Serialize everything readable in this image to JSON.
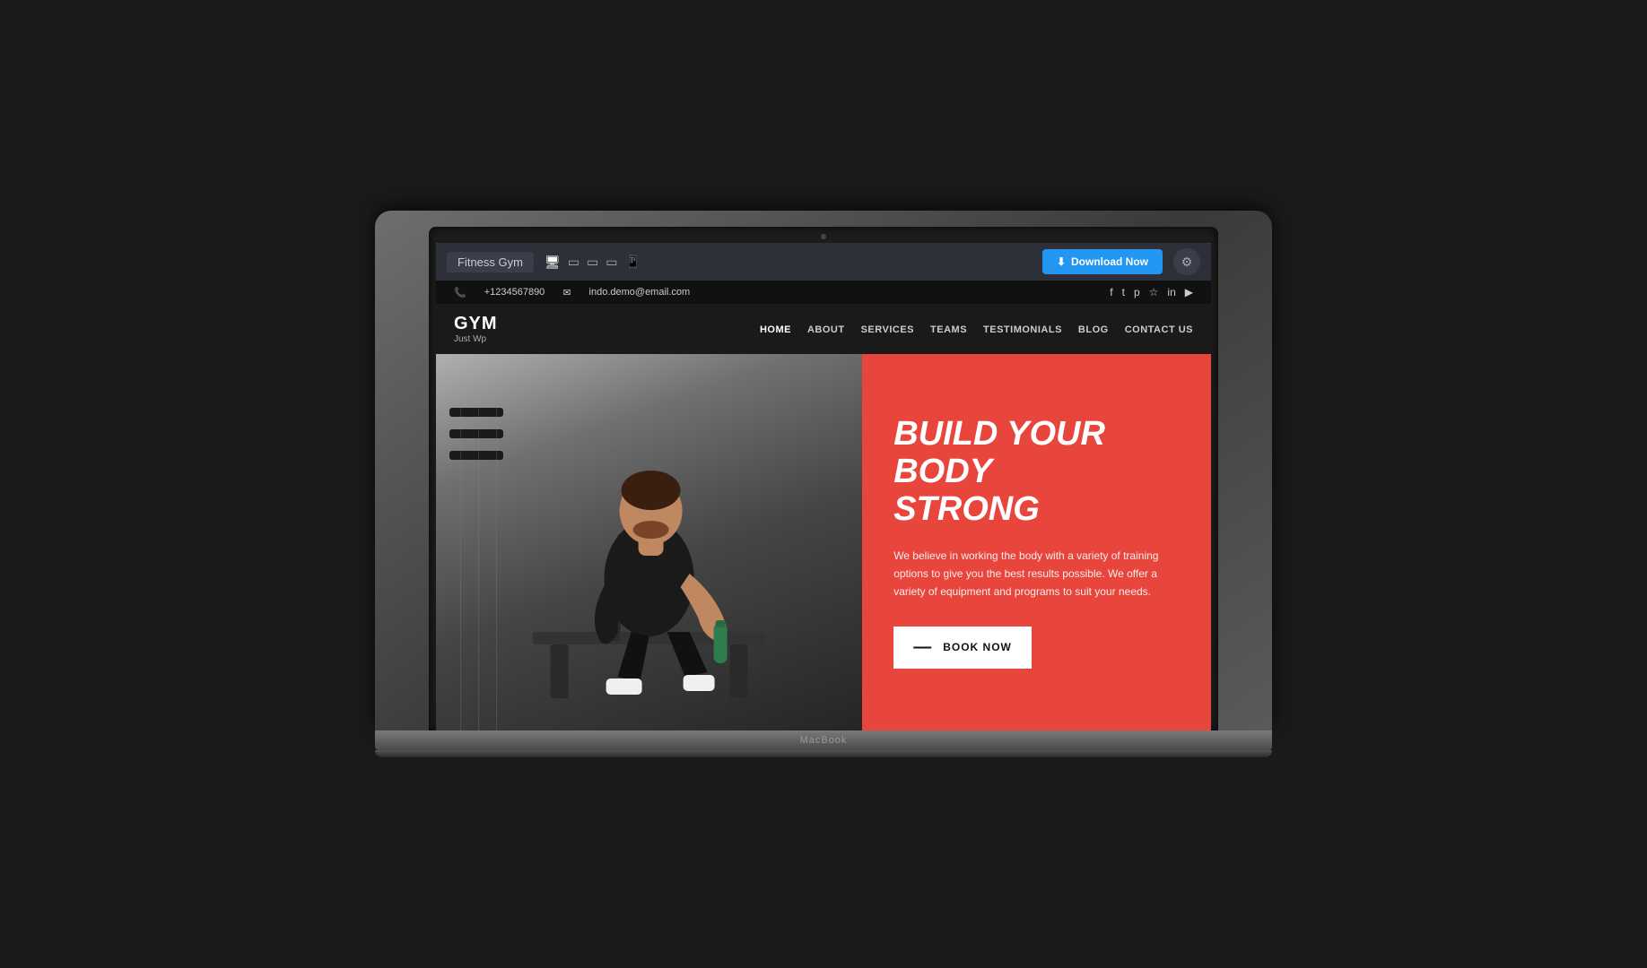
{
  "editor": {
    "template_name": "Fitness Gym",
    "download_btn": "Download Now",
    "settings_icon": "⚙",
    "download_icon": "⬇"
  },
  "contact_bar": {
    "phone": "+1234567890",
    "email": "indo.demo@email.com",
    "social_icons": [
      "f",
      "t",
      "p",
      "i",
      "in",
      "yt"
    ]
  },
  "nav": {
    "logo_name": "GYM",
    "logo_sub": "Just Wp",
    "links": [
      {
        "label": "HOME",
        "active": true
      },
      {
        "label": "ABOUT",
        "active": false
      },
      {
        "label": "SERVICES",
        "active": false
      },
      {
        "label": "TEAMS",
        "active": false
      },
      {
        "label": "TESTIMONIALS",
        "active": false
      },
      {
        "label": "BLOG",
        "active": false
      },
      {
        "label": "CONTACT US",
        "active": false
      }
    ]
  },
  "hero": {
    "headline_line1": "BUILD YOUR BODY",
    "headline_line2": "STRONG",
    "description": "We believe in working the body with a variety of training options to give you the best results possible. We offer a variety of equipment and programs to suit your needs.",
    "book_btn": "BOOK NOW"
  },
  "macbook_label": "MacBook",
  "colors": {
    "hero_bg": "#e8453c",
    "editor_bar": "#2d3038",
    "nav_bg": "#1a1a1a",
    "contact_bar_bg": "#111",
    "download_btn": "#2196f3",
    "book_btn_bg": "#fff",
    "book_btn_color": "#111"
  }
}
